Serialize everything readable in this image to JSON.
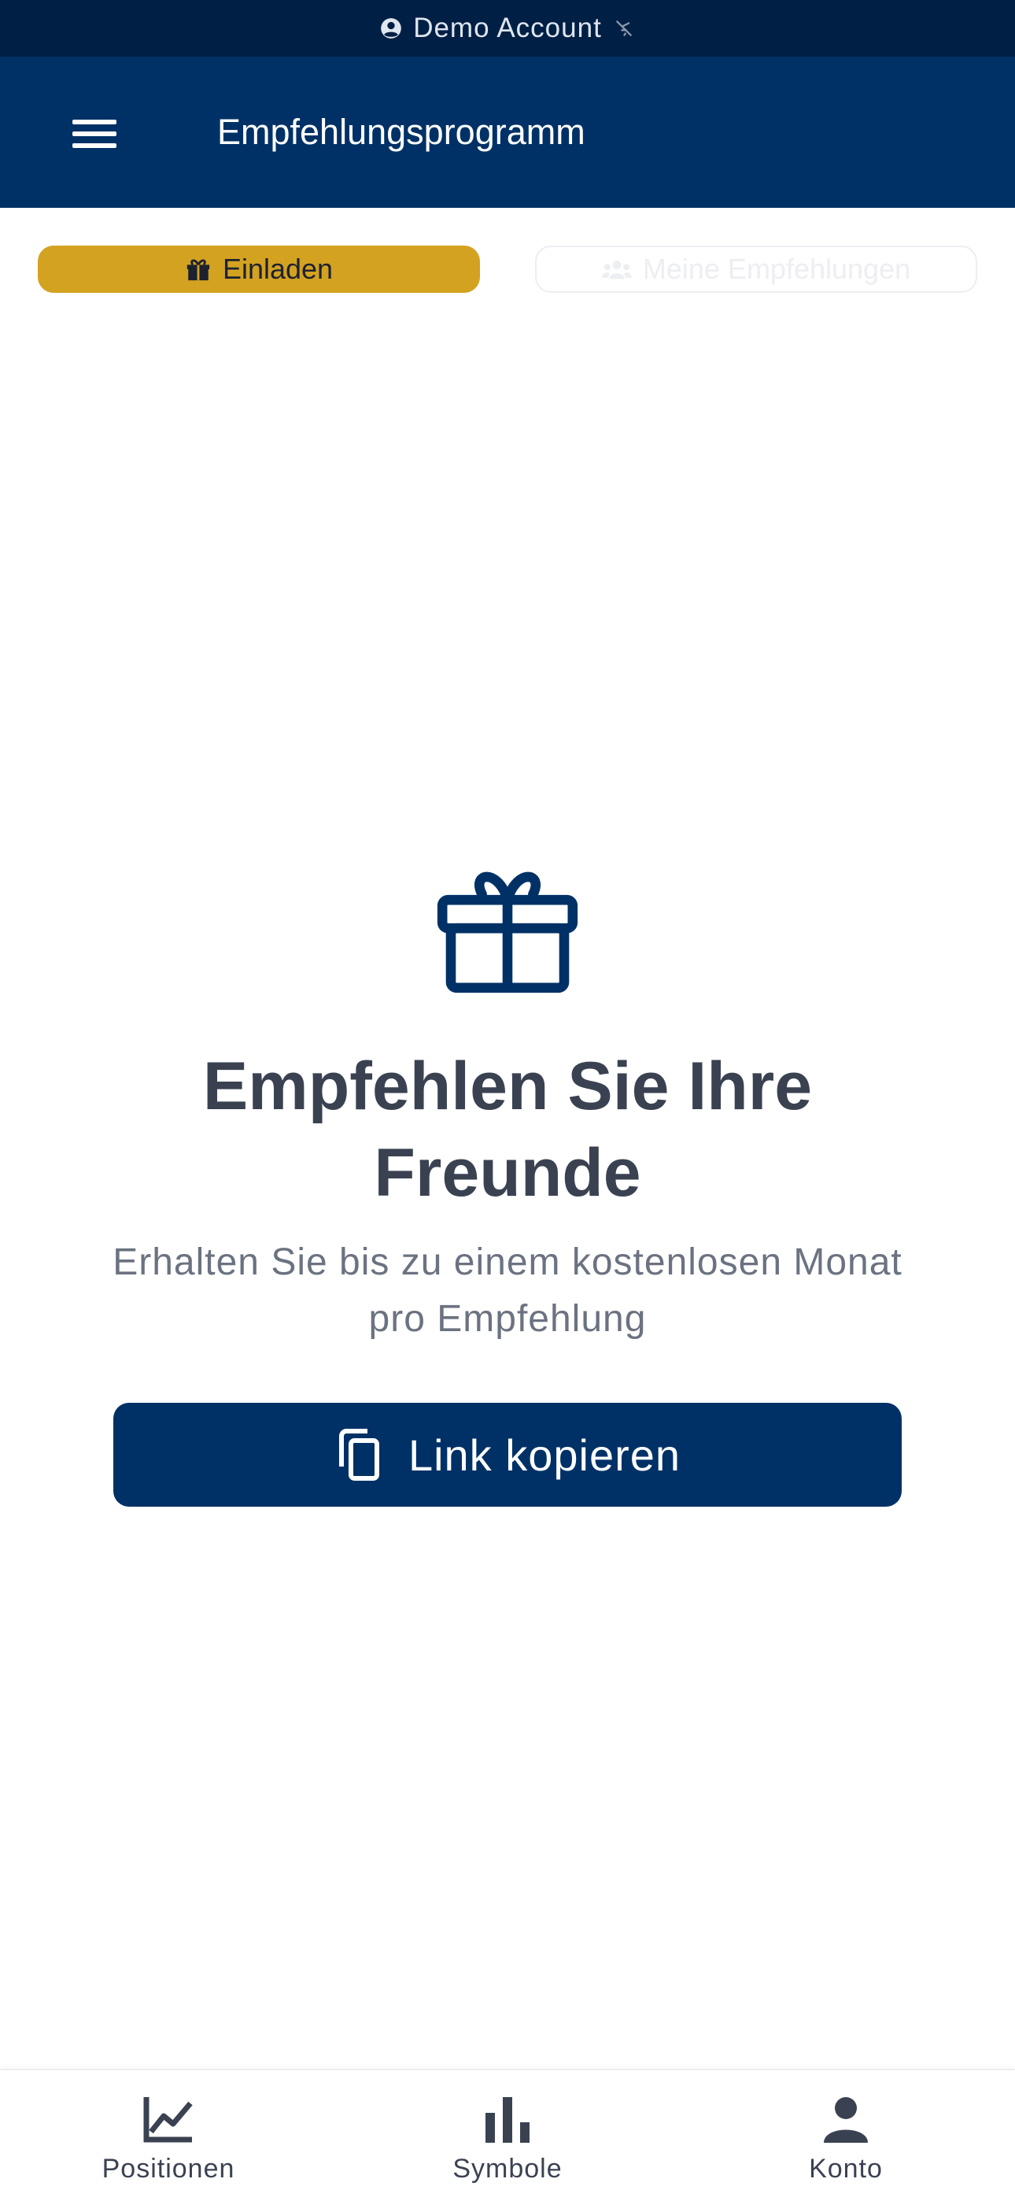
{
  "status_bar": {
    "account_label": "Demo Account",
    "account_icon": "account-circle-icon",
    "connection_icon": "wifi-off-icon"
  },
  "header": {
    "menu_icon": "hamburger-menu-icon",
    "title": "Empfehlungsprogramm"
  },
  "tabs": [
    {
      "label": "Einladen",
      "icon": "gift-icon",
      "active": true
    },
    {
      "label": "Meine Empfehlungen",
      "icon": "users-icon",
      "active": false
    }
  ],
  "hero": {
    "icon": "gift-icon",
    "title": "Empfehlen Sie Ihre Freunde",
    "subtitle": "Erhalten Sie bis zu einem kostenlosen Monat pro Empfehlung",
    "button_label": "Link kopieren",
    "button_icon": "copy-icon"
  },
  "bottom_nav": [
    {
      "label": "Positionen",
      "icon": "line-chart-icon"
    },
    {
      "label": "Symbole",
      "icon": "bar-chart-icon"
    },
    {
      "label": "Konto",
      "icon": "person-icon"
    }
  ],
  "colors": {
    "status_bar_bg": "#001f44",
    "primary": "#003166",
    "accent": "#d4a221",
    "text_dark": "#3a4252",
    "text_muted": "#6b7280"
  }
}
